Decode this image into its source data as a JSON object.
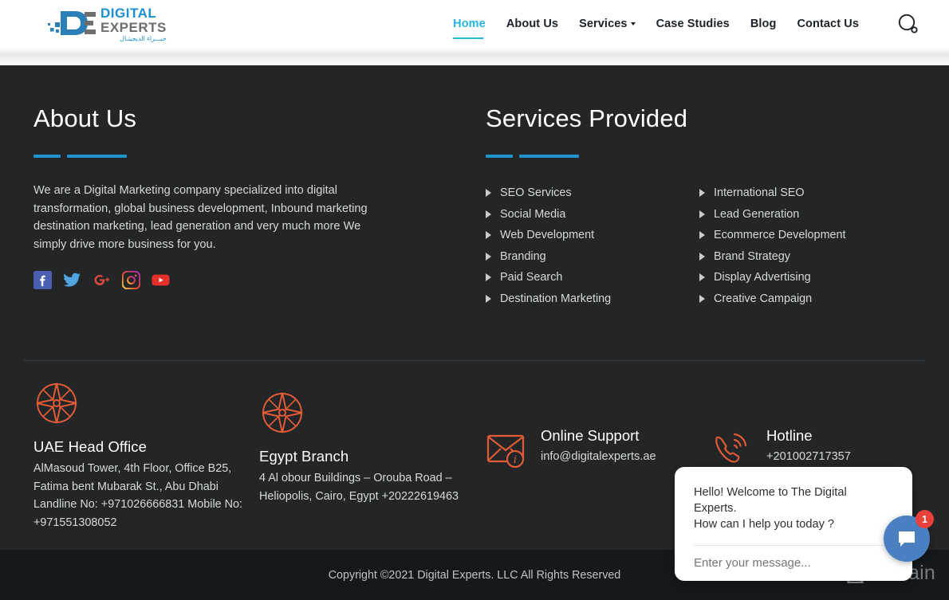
{
  "header": {
    "logo": {
      "line1": "DIGITAL",
      "line2": "EXPERTS",
      "line3": "خبـــراء الديجيتـال",
      "icon": "digital-experts-logo"
    },
    "nav": [
      {
        "label": "Home",
        "active": true
      },
      {
        "label": "About Us",
        "active": false
      },
      {
        "label": "Services",
        "active": false,
        "has_dropdown": true
      },
      {
        "label": "Case Studies",
        "active": false
      },
      {
        "label": "Blog",
        "active": false
      },
      {
        "label": "Contact Us",
        "active": false
      }
    ],
    "search_icon": "search-icon",
    "accent_color": "#22b8dd"
  },
  "footer": {
    "about": {
      "title": "About Us",
      "body": "We are a Digital Marketing company specialized into digital transformation, global business development, Inbound marketing destination marketing, lead generation and very much more We simply drive more business for you.",
      "social": [
        {
          "name": "facebook-icon",
          "color": "#4a5fb0"
        },
        {
          "name": "twitter-icon",
          "color": "#4fa5e0"
        },
        {
          "name": "google-plus-icon",
          "color": "#dc4a3d"
        },
        {
          "name": "instagram-icon",
          "color": "#c9399e"
        },
        {
          "name": "youtube-icon",
          "color": "#e8302a"
        }
      ]
    },
    "services": {
      "title": "Services Provided",
      "left": [
        "SEO Services",
        "Social Media",
        "Web Development",
        "Branding",
        "Paid Search",
        "Destination Marketing"
      ],
      "right": [
        "International SEO",
        "Lead Generation",
        "Ecommerce Development",
        "Brand Strategy",
        "Display Advertising",
        "Creative Campaign"
      ]
    },
    "accent_bar_color": "#2092cc",
    "contacts": {
      "uae": {
        "icon": "compass-icon",
        "name": "UAE Head Office",
        "address": "AlMasoud Tower, 4th Floor, Office B25, Fatima bent Mubarak St., Abu Dhabi Landline No: +971026666831 Mobile No: +971551308052"
      },
      "egypt": {
        "icon": "compass-icon",
        "name": "Egypt Branch",
        "address": "4 Al obour Buildings – Orouba Road – Heliopolis, Cairo, Egypt +20222619463"
      },
      "support": {
        "icon": "envelope-info-icon",
        "title": "Online Support",
        "value": "info@digitalexperts.ae"
      },
      "hotline": {
        "icon": "phone-ring-icon",
        "title": "Hotline",
        "value": "+201002717357"
      }
    },
    "copyright": "Copyright ©2021 Digital Experts. LLC All Rights Reserved"
  },
  "chat": {
    "greeting_line1": "Hello! Welcome to The Digital",
    "greeting_line2": "Experts.",
    "greeting_line3": "How can I help you today ?",
    "input_placeholder": "Enter your message...",
    "fab_icon": "chat-bubble-icon",
    "badge_count": "1",
    "fab_color": "#4a7fc1",
    "badge_color": "#e8413a"
  },
  "watermark": {
    "text": "Revain",
    "icon": "revain-logo-icon"
  }
}
